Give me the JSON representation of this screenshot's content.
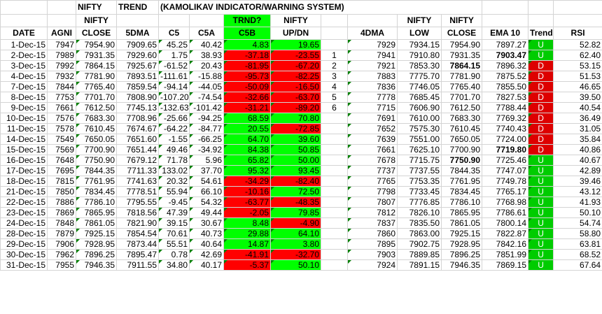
{
  "title_row": {
    "nifty": "NIFTY",
    "trend": "TREND",
    "system": "(KAMOLIKAV INDICATOR/WARNING SYSTEM)"
  },
  "headers": {
    "date": "DATE",
    "agni": "AGNI",
    "nifty_close_top": "NIFTY",
    "nifty_close_bot": "CLOSE",
    "dma5": "5DMA",
    "c5": "C5",
    "c5a": "C5A",
    "c5b_top": "TRND?",
    "c5b_bot": "C5B",
    "updn_top": "NIFTY",
    "updn_bot": "UP/DN",
    "dma4": "4DMA",
    "low_top": "NIFTY",
    "low_bot": "LOW",
    "close2_top": "NIFTY",
    "close2_bot": "CLOSE",
    "ema": "EMA 10",
    "trend": "Trend",
    "rsi": "RSI"
  },
  "colors": {
    "positive": "#00ff00",
    "negative": "#ff0000",
    "trend_up": "#00cc00",
    "trend_down": "#dd0000"
  },
  "rows": [
    {
      "date": "1-Dec-15",
      "agni": "7947",
      "close": "7954.90",
      "dma5": "7909.65",
      "c5": "45.25",
      "c5a": "40.42",
      "c5b": "4.83",
      "updn": "19.65",
      "cnt": "",
      "dma4": "7929",
      "low": "7934.15",
      "close2": "7954.90",
      "ema": "7897.27",
      "trend": "U",
      "rsi": "52.82"
    },
    {
      "date": "2-Dec-15",
      "agni": "7989",
      "close": "7931.35",
      "dma5": "7929.60",
      "c5": "1.75",
      "c5a": "38.93",
      "c5b": "-37.18",
      "updn": "-23.55",
      "cnt": "1",
      "dma4": "7941",
      "low": "7910.80",
      "close2": "7931.35",
      "ema": "7903.47",
      "trend": "U",
      "rsi": "62.40"
    },
    {
      "date": "3-Dec-15",
      "agni": "7992",
      "close": "7864.15",
      "dma5": "7925.67",
      "c5": "-61.52",
      "c5a": "20.43",
      "c5b": "-81.95",
      "updn": "-67.20",
      "cnt": "2",
      "dma4": "7921",
      "low": "7853.30",
      "close2": "7864.15",
      "ema": "7896.32",
      "trend": "D",
      "rsi": "53.15"
    },
    {
      "date": "4-Dec-15",
      "agni": "7932",
      "close": "7781.90",
      "dma5": "7893.51",
      "c5": "-111.61",
      "c5a": "-15.88",
      "c5b": "-95.73",
      "updn": "-82.25",
      "cnt": "3",
      "dma4": "7883",
      "low": "7775.70",
      "close2": "7781.90",
      "ema": "7875.52",
      "trend": "D",
      "rsi": "51.53"
    },
    {
      "date": "7-Dec-15",
      "agni": "7844",
      "close": "7765.40",
      "dma5": "7859.54",
      "c5": "-94.14",
      "c5a": "-44.05",
      "c5b": "-50.09",
      "updn": "-16.50",
      "cnt": "4",
      "dma4": "7836",
      "low": "7746.05",
      "close2": "7765.40",
      "ema": "7855.50",
      "trend": "D",
      "rsi": "46.65"
    },
    {
      "date": "8-Dec-15",
      "agni": "7753",
      "close": "7701.70",
      "dma5": "7808.90",
      "c5": "-107.20",
      "c5a": "-74.54",
      "c5b": "-32.66",
      "updn": "-63.70",
      "cnt": "5",
      "dma4": "7778",
      "low": "7685.45",
      "close2": "7701.70",
      "ema": "7827.53",
      "trend": "D",
      "rsi": "39.50"
    },
    {
      "date": "9-Dec-15",
      "agni": "7661",
      "close": "7612.50",
      "dma5": "7745.13",
      "c5": "-132.63",
      "c5a": "-101.42",
      "c5b": "-31.21",
      "updn": "-89.20",
      "cnt": "6",
      "dma4": "7715",
      "low": "7606.90",
      "close2": "7612.50",
      "ema": "7788.44",
      "trend": "D",
      "rsi": "40.54"
    },
    {
      "date": "10-Dec-15",
      "agni": "7576",
      "close": "7683.30",
      "dma5": "7708.96",
      "c5": "-25.66",
      "c5a": "-94.25",
      "c5b": "68.59",
      "updn": "70.80",
      "cnt": "",
      "dma4": "7691",
      "low": "7610.00",
      "close2": "7683.30",
      "ema": "7769.32",
      "trend": "D",
      "rsi": "36.49"
    },
    {
      "date": "11-Dec-15",
      "agni": "7578",
      "close": "7610.45",
      "dma5": "7674.67",
      "c5": "-64.22",
      "c5a": "-84.77",
      "c5b": "20.55",
      "updn": "-72.85",
      "cnt": "",
      "dma4": "7652",
      "low": "7575.30",
      "close2": "7610.45",
      "ema": "7740.43",
      "trend": "D",
      "rsi": "31.05"
    },
    {
      "date": "14-Dec-15",
      "agni": "7549",
      "close": "7650.05",
      "dma5": "7651.60",
      "c5": "-1.55",
      "c5a": "-66.25",
      "c5b": "64.70",
      "updn": "39.60",
      "cnt": "",
      "dma4": "7639",
      "low": "7551.00",
      "close2": "7650.05",
      "ema": "7724.00",
      "trend": "D",
      "rsi": "35.84"
    },
    {
      "date": "15-Dec-15",
      "agni": "7569",
      "close": "7700.90",
      "dma5": "7651.44",
      "c5": "49.46",
      "c5a": "-34.92",
      "c5b": "84.38",
      "updn": "50.85",
      "cnt": "",
      "dma4": "7661",
      "low": "7625.10",
      "close2": "7700.90",
      "ema": "7719.80",
      "trend": "D",
      "rsi": "40.86"
    },
    {
      "date": "16-Dec-15",
      "agni": "7648",
      "close": "7750.90",
      "dma5": "7679.12",
      "c5": "71.78",
      "c5a": "5.96",
      "c5b": "65.82",
      "updn": "50.00",
      "cnt": "",
      "dma4": "7678",
      "low": "7715.75",
      "close2": "7750.90",
      "ema": "7725.46",
      "trend": "U",
      "rsi": "40.67"
    },
    {
      "date": "17-Dec-15",
      "agni": "7695",
      "close": "7844.35",
      "dma5": "7711.33",
      "c5": "133.02",
      "c5a": "37.70",
      "c5b": "95.32",
      "updn": "93.45",
      "cnt": "",
      "dma4": "7737",
      "low": "7737.55",
      "close2": "7844.35",
      "ema": "7747.07",
      "trend": "U",
      "rsi": "42.89"
    },
    {
      "date": "18-Dec-15",
      "agni": "7815",
      "close": "7761.95",
      "dma5": "7741.63",
      "c5": "20.32",
      "c5a": "54.61",
      "c5b": "-34.29",
      "updn": "-82.40",
      "cnt": "",
      "dma4": "7765",
      "low": "7753.35",
      "close2": "7761.95",
      "ema": "7749.78",
      "trend": "U",
      "rsi": "39.46"
    },
    {
      "date": "21-Dec-15",
      "agni": "7850",
      "close": "7834.45",
      "dma5": "7778.51",
      "c5": "55.94",
      "c5a": "66.10",
      "c5b": "-10.16",
      "updn": "72.50",
      "cnt": "",
      "dma4": "7798",
      "low": "7733.45",
      "close2": "7834.45",
      "ema": "7765.17",
      "trend": "U",
      "rsi": "43.12"
    },
    {
      "date": "22-Dec-15",
      "agni": "7886",
      "close": "7786.10",
      "dma5": "7795.55",
      "c5": "-9.45",
      "c5a": "54.32",
      "c5b": "-63.77",
      "updn": "-48.35",
      "cnt": "",
      "dma4": "7807",
      "low": "7776.85",
      "close2": "7786.10",
      "ema": "7768.98",
      "trend": "U",
      "rsi": "41.93"
    },
    {
      "date": "23-Dec-15",
      "agni": "7869",
      "close": "7865.95",
      "dma5": "7818.56",
      "c5": "47.39",
      "c5a": "49.44",
      "c5b": "-2.05",
      "updn": "79.85",
      "cnt": "",
      "dma4": "7812",
      "low": "7826.10",
      "close2": "7865.95",
      "ema": "7786.61",
      "trend": "U",
      "rsi": "50.10"
    },
    {
      "date": "24-Dec-15",
      "agni": "7848",
      "close": "7861.05",
      "dma5": "7821.90",
      "c5": "39.15",
      "c5a": "30.67",
      "c5b": "8.48",
      "updn": "-4.90",
      "cnt": "",
      "dma4": "7837",
      "low": "7835.50",
      "close2": "7861.05",
      "ema": "7800.14",
      "trend": "U",
      "rsi": "54.74"
    },
    {
      "date": "28-Dec-15",
      "agni": "7879",
      "close": "7925.15",
      "dma5": "7854.54",
      "c5": "70.61",
      "c5a": "40.73",
      "c5b": "29.88",
      "updn": "64.10",
      "cnt": "",
      "dma4": "7860",
      "low": "7863.00",
      "close2": "7925.15",
      "ema": "7822.87",
      "trend": "U",
      "rsi": "58.80"
    },
    {
      "date": "29-Dec-15",
      "agni": "7906",
      "close": "7928.95",
      "dma5": "7873.44",
      "c5": "55.51",
      "c5a": "40.64",
      "c5b": "14.87",
      "updn": "3.80",
      "cnt": "",
      "dma4": "7895",
      "low": "7902.75",
      "close2": "7928.95",
      "ema": "7842.16",
      "trend": "U",
      "rsi": "63.81"
    },
    {
      "date": "30-Dec-15",
      "agni": "7962",
      "close": "7896.25",
      "dma5": "7895.47",
      "c5": "0.78",
      "c5a": "42.69",
      "c5b": "-41.91",
      "updn": "-32.70",
      "cnt": "",
      "dma4": "7903",
      "low": "7889.85",
      "close2": "7896.25",
      "ema": "7851.99",
      "trend": "U",
      "rsi": "68.52"
    },
    {
      "date": "31-Dec-15",
      "agni": "7955",
      "close": "7946.35",
      "dma5": "7911.55",
      "c5": "34.80",
      "c5a": "40.17",
      "c5b": "-5.37",
      "updn": "50.10",
      "cnt": "",
      "dma4": "7924",
      "low": "7891.15",
      "close2": "7946.35",
      "ema": "7869.15",
      "trend": "U",
      "rsi": "67.64"
    }
  ]
}
